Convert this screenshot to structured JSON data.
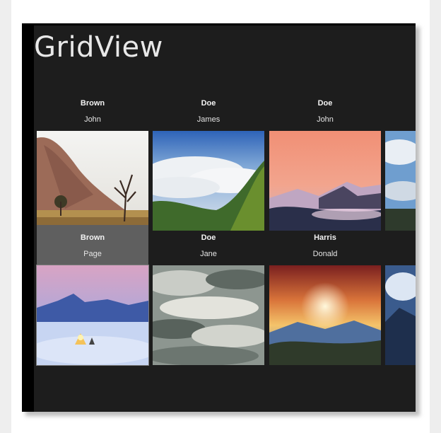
{
  "app": {
    "title": "GridView"
  },
  "items": [
    {
      "last": "Brown",
      "first": "John",
      "image": "desert-hill-dead-tree-photo",
      "selected": false
    },
    {
      "last": "Doe",
      "first": "James",
      "image": "clouds-valley-green-hills-photo",
      "selected": false
    },
    {
      "last": "Doe",
      "first": "John",
      "image": "pink-sky-mountain-fog-photo",
      "selected": false
    },
    {
      "last": "",
      "first": "",
      "image": "blue-sky-clouds-photo-partial",
      "selected": false
    },
    {
      "last": "Brown",
      "first": "Page",
      "image": "snow-mountain-tent-night-photo",
      "selected": true
    },
    {
      "last": "Doe",
      "first": "Jane",
      "image": "stormy-clouds-photo",
      "selected": false
    },
    {
      "last": "Harris",
      "first": "Donald",
      "image": "sunset-sun-rays-mountains-photo",
      "selected": false
    },
    {
      "last": "",
      "first": "",
      "image": "blue-mountain-photo-partial",
      "selected": false
    }
  ]
}
